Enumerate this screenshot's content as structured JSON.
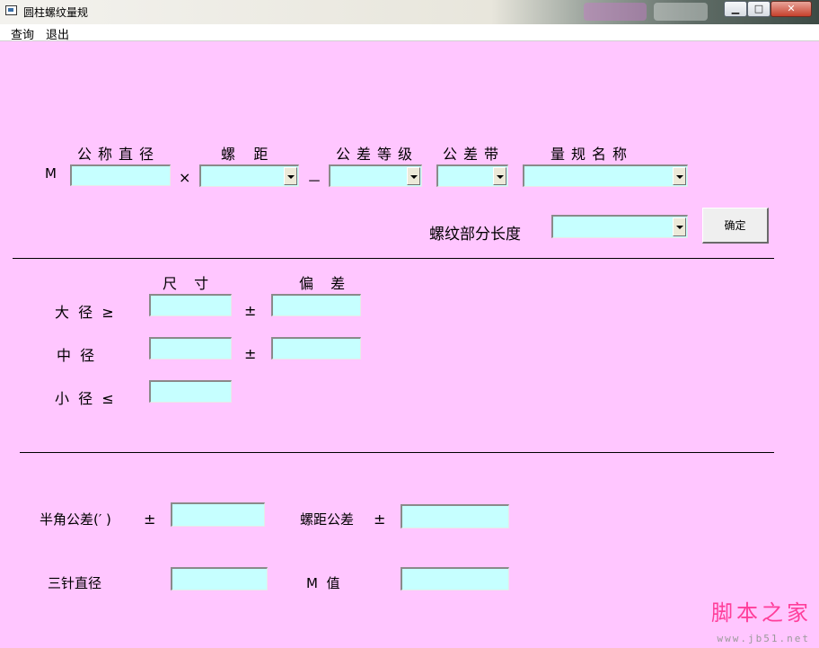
{
  "window": {
    "title": "圆柱螺纹量规"
  },
  "menu": {
    "query": "查询",
    "exit": "退出"
  },
  "spec": {
    "prefix": "M",
    "nominal_diameter_label": "公称直径",
    "pitch_label": "螺    距",
    "tolerance_grade_label": "公差等级",
    "tolerance_zone_label": "公差带",
    "gauge_name_label": "量规名称",
    "times": "×",
    "dash": "－",
    "thread_length_label": "螺纹部分长度",
    "confirm_button": "确定"
  },
  "dims": {
    "size_header": "尺 寸",
    "deviation_header": "偏 差",
    "major_label": "大  径  ≥",
    "pitch_dia_label": "中  径",
    "minor_label": "小  径  ≤",
    "pm": "±"
  },
  "bottom": {
    "half_angle_label": "半角公差(′ )",
    "pitch_tol_label": "螺距公差",
    "pm": "±",
    "three_wire_label": "三针直径",
    "m_value_label": "M  值"
  },
  "watermark": {
    "text": "脚本之家",
    "url": "www.jb51.net"
  },
  "colors": {
    "background": "#ffc6ff",
    "field": "#c6ffff"
  }
}
